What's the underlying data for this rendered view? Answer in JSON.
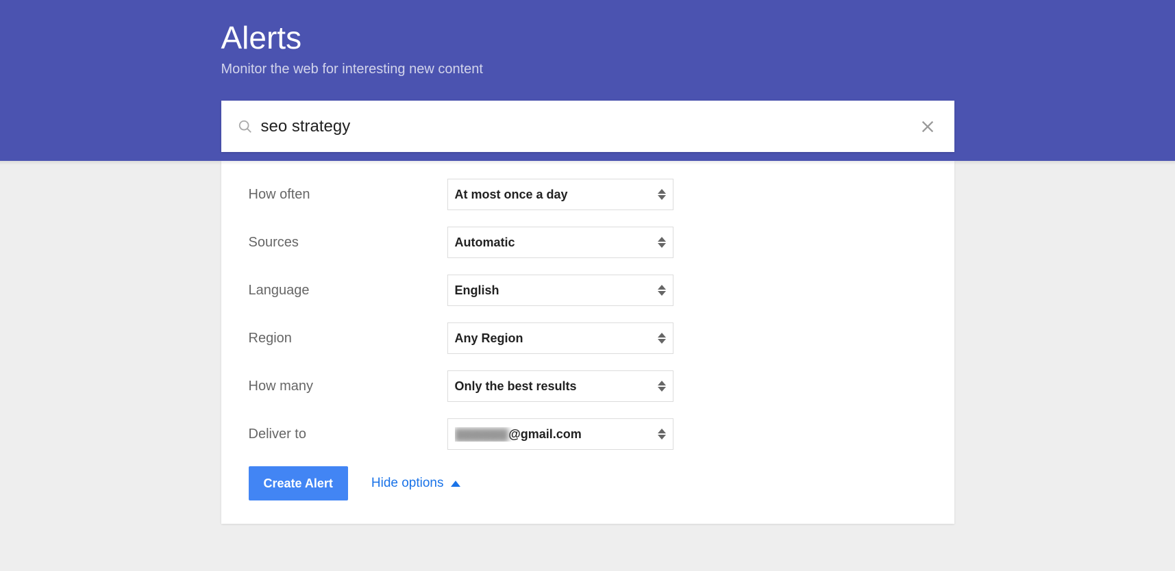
{
  "header": {
    "title": "Alerts",
    "subtitle": "Monitor the web for interesting new content"
  },
  "search": {
    "value": "seo strategy",
    "placeholder": ""
  },
  "options": {
    "how_often": {
      "label": "How often",
      "value": "At most once a day"
    },
    "sources": {
      "label": "Sources",
      "value": "Automatic"
    },
    "language": {
      "label": "Language",
      "value": "English"
    },
    "region": {
      "label": "Region",
      "value": "Any Region"
    },
    "how_many": {
      "label": "How many",
      "value": "Only the best results"
    },
    "deliver_to": {
      "label": "Deliver to",
      "redacted_value": "▓▓▓▓▓▓",
      "suffix": "@gmail.com"
    }
  },
  "actions": {
    "create_label": "Create Alert",
    "hide_label": "Hide options"
  }
}
